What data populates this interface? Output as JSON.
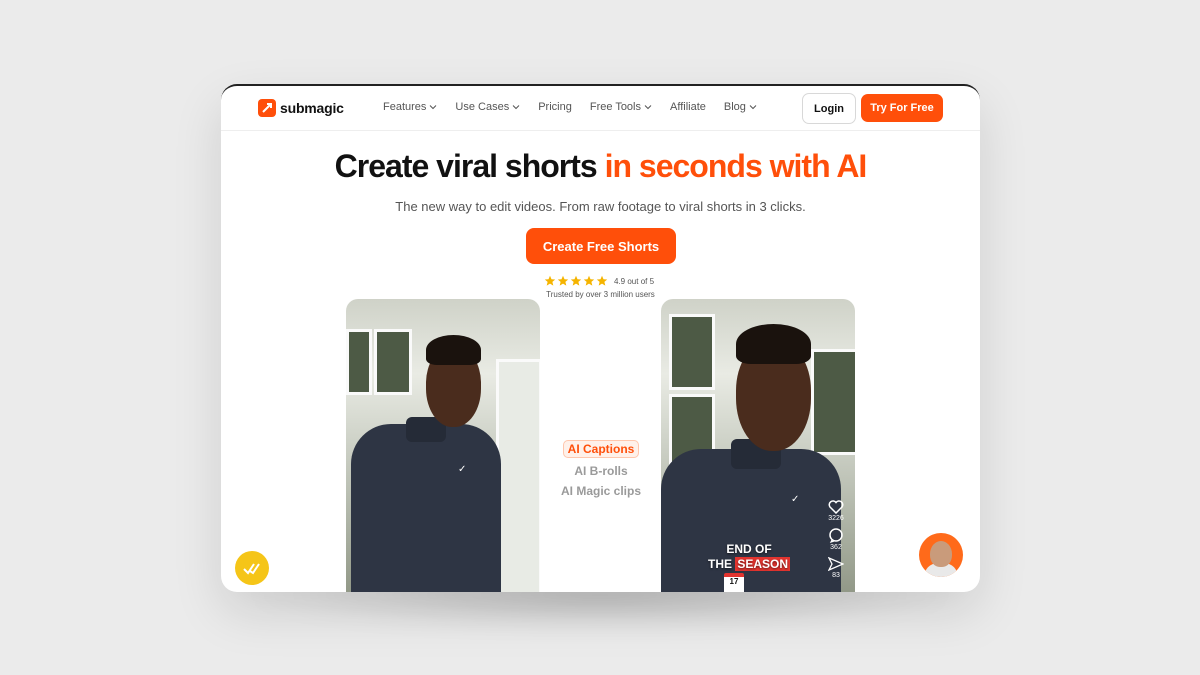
{
  "brand": {
    "name": "submagic",
    "accent": "#ff4f0a"
  },
  "nav": {
    "items": [
      {
        "label": "Features",
        "dropdown": true
      },
      {
        "label": "Use Cases",
        "dropdown": true
      },
      {
        "label": "Pricing",
        "dropdown": false
      },
      {
        "label": "Free Tools",
        "dropdown": true
      },
      {
        "label": "Affiliate",
        "dropdown": false
      },
      {
        "label": "Blog",
        "dropdown": true
      }
    ],
    "login_label": "Login",
    "try_label": "Try For Free"
  },
  "hero": {
    "title_main": "Create viral shorts ",
    "title_accent": "in seconds with AI",
    "subtitle": "The new way to edit videos. From raw footage to viral shorts in 3 clicks.",
    "cta_label": "Create Free Shorts",
    "rating_text": "4.9 out of 5",
    "rating_value": 4.9,
    "star_count": 5,
    "trust_text": "Trusted by over 3 million users"
  },
  "features": {
    "active": "AI Captions",
    "others": [
      "AI B-rolls",
      "AI Magic clips"
    ]
  },
  "video_right": {
    "likes": "3226",
    "comments": "362",
    "shares": "83",
    "caption_line1": "END OF",
    "caption_line2_prefix": "THE ",
    "caption_line2_highlight": "SEASON",
    "calendar_day": "17"
  },
  "icons": {
    "like": "heart-icon",
    "comment": "comment-icon",
    "share": "send-icon",
    "chevron": "chevron-down-icon",
    "star": "star-icon",
    "helper": "checkmark-badge-icon"
  }
}
